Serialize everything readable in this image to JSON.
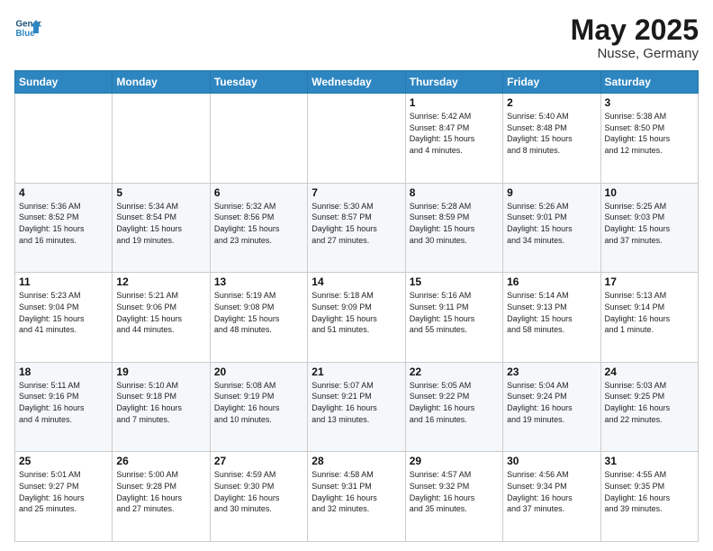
{
  "header": {
    "logo_line1": "General",
    "logo_line2": "Blue",
    "month": "May 2025",
    "location": "Nusse, Germany"
  },
  "weekdays": [
    "Sunday",
    "Monday",
    "Tuesday",
    "Wednesday",
    "Thursday",
    "Friday",
    "Saturday"
  ],
  "weeks": [
    [
      {
        "day": "",
        "info": ""
      },
      {
        "day": "",
        "info": ""
      },
      {
        "day": "",
        "info": ""
      },
      {
        "day": "",
        "info": ""
      },
      {
        "day": "1",
        "info": "Sunrise: 5:42 AM\nSunset: 8:47 PM\nDaylight: 15 hours\nand 4 minutes."
      },
      {
        "day": "2",
        "info": "Sunrise: 5:40 AM\nSunset: 8:48 PM\nDaylight: 15 hours\nand 8 minutes."
      },
      {
        "day": "3",
        "info": "Sunrise: 5:38 AM\nSunset: 8:50 PM\nDaylight: 15 hours\nand 12 minutes."
      }
    ],
    [
      {
        "day": "4",
        "info": "Sunrise: 5:36 AM\nSunset: 8:52 PM\nDaylight: 15 hours\nand 16 minutes."
      },
      {
        "day": "5",
        "info": "Sunrise: 5:34 AM\nSunset: 8:54 PM\nDaylight: 15 hours\nand 19 minutes."
      },
      {
        "day": "6",
        "info": "Sunrise: 5:32 AM\nSunset: 8:56 PM\nDaylight: 15 hours\nand 23 minutes."
      },
      {
        "day": "7",
        "info": "Sunrise: 5:30 AM\nSunset: 8:57 PM\nDaylight: 15 hours\nand 27 minutes."
      },
      {
        "day": "8",
        "info": "Sunrise: 5:28 AM\nSunset: 8:59 PM\nDaylight: 15 hours\nand 30 minutes."
      },
      {
        "day": "9",
        "info": "Sunrise: 5:26 AM\nSunset: 9:01 PM\nDaylight: 15 hours\nand 34 minutes."
      },
      {
        "day": "10",
        "info": "Sunrise: 5:25 AM\nSunset: 9:03 PM\nDaylight: 15 hours\nand 37 minutes."
      }
    ],
    [
      {
        "day": "11",
        "info": "Sunrise: 5:23 AM\nSunset: 9:04 PM\nDaylight: 15 hours\nand 41 minutes."
      },
      {
        "day": "12",
        "info": "Sunrise: 5:21 AM\nSunset: 9:06 PM\nDaylight: 15 hours\nand 44 minutes."
      },
      {
        "day": "13",
        "info": "Sunrise: 5:19 AM\nSunset: 9:08 PM\nDaylight: 15 hours\nand 48 minutes."
      },
      {
        "day": "14",
        "info": "Sunrise: 5:18 AM\nSunset: 9:09 PM\nDaylight: 15 hours\nand 51 minutes."
      },
      {
        "day": "15",
        "info": "Sunrise: 5:16 AM\nSunset: 9:11 PM\nDaylight: 15 hours\nand 55 minutes."
      },
      {
        "day": "16",
        "info": "Sunrise: 5:14 AM\nSunset: 9:13 PM\nDaylight: 15 hours\nand 58 minutes."
      },
      {
        "day": "17",
        "info": "Sunrise: 5:13 AM\nSunset: 9:14 PM\nDaylight: 16 hours\nand 1 minute."
      }
    ],
    [
      {
        "day": "18",
        "info": "Sunrise: 5:11 AM\nSunset: 9:16 PM\nDaylight: 16 hours\nand 4 minutes."
      },
      {
        "day": "19",
        "info": "Sunrise: 5:10 AM\nSunset: 9:18 PM\nDaylight: 16 hours\nand 7 minutes."
      },
      {
        "day": "20",
        "info": "Sunrise: 5:08 AM\nSunset: 9:19 PM\nDaylight: 16 hours\nand 10 minutes."
      },
      {
        "day": "21",
        "info": "Sunrise: 5:07 AM\nSunset: 9:21 PM\nDaylight: 16 hours\nand 13 minutes."
      },
      {
        "day": "22",
        "info": "Sunrise: 5:05 AM\nSunset: 9:22 PM\nDaylight: 16 hours\nand 16 minutes."
      },
      {
        "day": "23",
        "info": "Sunrise: 5:04 AM\nSunset: 9:24 PM\nDaylight: 16 hours\nand 19 minutes."
      },
      {
        "day": "24",
        "info": "Sunrise: 5:03 AM\nSunset: 9:25 PM\nDaylight: 16 hours\nand 22 minutes."
      }
    ],
    [
      {
        "day": "25",
        "info": "Sunrise: 5:01 AM\nSunset: 9:27 PM\nDaylight: 16 hours\nand 25 minutes."
      },
      {
        "day": "26",
        "info": "Sunrise: 5:00 AM\nSunset: 9:28 PM\nDaylight: 16 hours\nand 27 minutes."
      },
      {
        "day": "27",
        "info": "Sunrise: 4:59 AM\nSunset: 9:30 PM\nDaylight: 16 hours\nand 30 minutes."
      },
      {
        "day": "28",
        "info": "Sunrise: 4:58 AM\nSunset: 9:31 PM\nDaylight: 16 hours\nand 32 minutes."
      },
      {
        "day": "29",
        "info": "Sunrise: 4:57 AM\nSunset: 9:32 PM\nDaylight: 16 hours\nand 35 minutes."
      },
      {
        "day": "30",
        "info": "Sunrise: 4:56 AM\nSunset: 9:34 PM\nDaylight: 16 hours\nand 37 minutes."
      },
      {
        "day": "31",
        "info": "Sunrise: 4:55 AM\nSunset: 9:35 PM\nDaylight: 16 hours\nand 39 minutes."
      }
    ]
  ]
}
